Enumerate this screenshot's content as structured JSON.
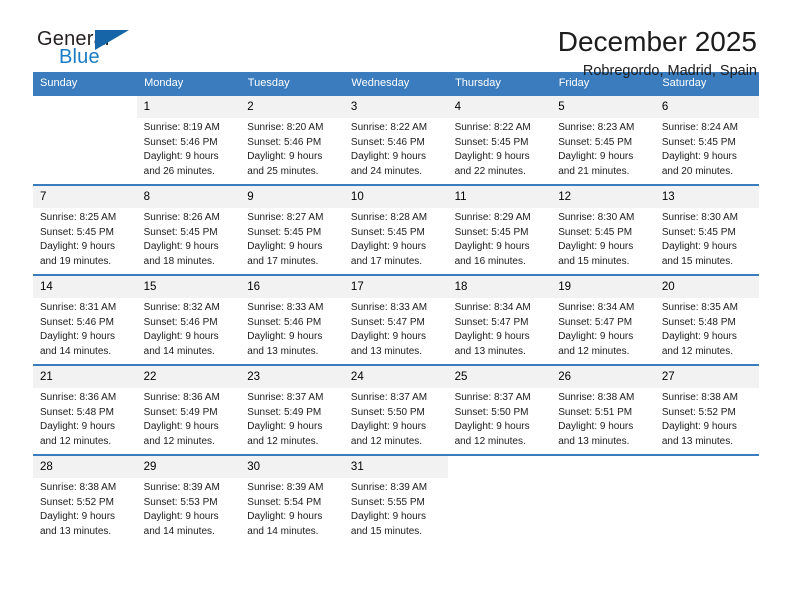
{
  "brand": {
    "name_part1": "General",
    "name_part2": "Blue",
    "triangle_color": "#1565a8",
    "blue_text_color": "#1a7cc4"
  },
  "header": {
    "title": "December 2025",
    "subtitle": "Robregordo, Madrid, Spain"
  },
  "theme": {
    "header_row_bg": "#3a7cbe",
    "daynum_bg": "#f2f2f2",
    "text_color": "#1c1c1c"
  },
  "calendar": {
    "weekday_headers": [
      "Sunday",
      "Monday",
      "Tuesday",
      "Wednesday",
      "Thursday",
      "Friday",
      "Saturday"
    ],
    "weeks": [
      [
        {
          "day": "",
          "lines": []
        },
        {
          "day": "1",
          "lines": [
            "Sunrise: 8:19 AM",
            "Sunset: 5:46 PM",
            "Daylight: 9 hours",
            "and 26 minutes."
          ]
        },
        {
          "day": "2",
          "lines": [
            "Sunrise: 8:20 AM",
            "Sunset: 5:46 PM",
            "Daylight: 9 hours",
            "and 25 minutes."
          ]
        },
        {
          "day": "3",
          "lines": [
            "Sunrise: 8:22 AM",
            "Sunset: 5:46 PM",
            "Daylight: 9 hours",
            "and 24 minutes."
          ]
        },
        {
          "day": "4",
          "lines": [
            "Sunrise: 8:22 AM",
            "Sunset: 5:45 PM",
            "Daylight: 9 hours",
            "and 22 minutes."
          ]
        },
        {
          "day": "5",
          "lines": [
            "Sunrise: 8:23 AM",
            "Sunset: 5:45 PM",
            "Daylight: 9 hours",
            "and 21 minutes."
          ]
        },
        {
          "day": "6",
          "lines": [
            "Sunrise: 8:24 AM",
            "Sunset: 5:45 PM",
            "Daylight: 9 hours",
            "and 20 minutes."
          ]
        }
      ],
      [
        {
          "day": "7",
          "lines": [
            "Sunrise: 8:25 AM",
            "Sunset: 5:45 PM",
            "Daylight: 9 hours",
            "and 19 minutes."
          ]
        },
        {
          "day": "8",
          "lines": [
            "Sunrise: 8:26 AM",
            "Sunset: 5:45 PM",
            "Daylight: 9 hours",
            "and 18 minutes."
          ]
        },
        {
          "day": "9",
          "lines": [
            "Sunrise: 8:27 AM",
            "Sunset: 5:45 PM",
            "Daylight: 9 hours",
            "and 17 minutes."
          ]
        },
        {
          "day": "10",
          "lines": [
            "Sunrise: 8:28 AM",
            "Sunset: 5:45 PM",
            "Daylight: 9 hours",
            "and 17 minutes."
          ]
        },
        {
          "day": "11",
          "lines": [
            "Sunrise: 8:29 AM",
            "Sunset: 5:45 PM",
            "Daylight: 9 hours",
            "and 16 minutes."
          ]
        },
        {
          "day": "12",
          "lines": [
            "Sunrise: 8:30 AM",
            "Sunset: 5:45 PM",
            "Daylight: 9 hours",
            "and 15 minutes."
          ]
        },
        {
          "day": "13",
          "lines": [
            "Sunrise: 8:30 AM",
            "Sunset: 5:45 PM",
            "Daylight: 9 hours",
            "and 15 minutes."
          ]
        }
      ],
      [
        {
          "day": "14",
          "lines": [
            "Sunrise: 8:31 AM",
            "Sunset: 5:46 PM",
            "Daylight: 9 hours",
            "and 14 minutes."
          ]
        },
        {
          "day": "15",
          "lines": [
            "Sunrise: 8:32 AM",
            "Sunset: 5:46 PM",
            "Daylight: 9 hours",
            "and 14 minutes."
          ]
        },
        {
          "day": "16",
          "lines": [
            "Sunrise: 8:33 AM",
            "Sunset: 5:46 PM",
            "Daylight: 9 hours",
            "and 13 minutes."
          ]
        },
        {
          "day": "17",
          "lines": [
            "Sunrise: 8:33 AM",
            "Sunset: 5:47 PM",
            "Daylight: 9 hours",
            "and 13 minutes."
          ]
        },
        {
          "day": "18",
          "lines": [
            "Sunrise: 8:34 AM",
            "Sunset: 5:47 PM",
            "Daylight: 9 hours",
            "and 13 minutes."
          ]
        },
        {
          "day": "19",
          "lines": [
            "Sunrise: 8:34 AM",
            "Sunset: 5:47 PM",
            "Daylight: 9 hours",
            "and 12 minutes."
          ]
        },
        {
          "day": "20",
          "lines": [
            "Sunrise: 8:35 AM",
            "Sunset: 5:48 PM",
            "Daylight: 9 hours",
            "and 12 minutes."
          ]
        }
      ],
      [
        {
          "day": "21",
          "lines": [
            "Sunrise: 8:36 AM",
            "Sunset: 5:48 PM",
            "Daylight: 9 hours",
            "and 12 minutes."
          ]
        },
        {
          "day": "22",
          "lines": [
            "Sunrise: 8:36 AM",
            "Sunset: 5:49 PM",
            "Daylight: 9 hours",
            "and 12 minutes."
          ]
        },
        {
          "day": "23",
          "lines": [
            "Sunrise: 8:37 AM",
            "Sunset: 5:49 PM",
            "Daylight: 9 hours",
            "and 12 minutes."
          ]
        },
        {
          "day": "24",
          "lines": [
            "Sunrise: 8:37 AM",
            "Sunset: 5:50 PM",
            "Daylight: 9 hours",
            "and 12 minutes."
          ]
        },
        {
          "day": "25",
          "lines": [
            "Sunrise: 8:37 AM",
            "Sunset: 5:50 PM",
            "Daylight: 9 hours",
            "and 12 minutes."
          ]
        },
        {
          "day": "26",
          "lines": [
            "Sunrise: 8:38 AM",
            "Sunset: 5:51 PM",
            "Daylight: 9 hours",
            "and 13 minutes."
          ]
        },
        {
          "day": "27",
          "lines": [
            "Sunrise: 8:38 AM",
            "Sunset: 5:52 PM",
            "Daylight: 9 hours",
            "and 13 minutes."
          ]
        }
      ],
      [
        {
          "day": "28",
          "lines": [
            "Sunrise: 8:38 AM",
            "Sunset: 5:52 PM",
            "Daylight: 9 hours",
            "and 13 minutes."
          ]
        },
        {
          "day": "29",
          "lines": [
            "Sunrise: 8:39 AM",
            "Sunset: 5:53 PM",
            "Daylight: 9 hours",
            "and 14 minutes."
          ]
        },
        {
          "day": "30",
          "lines": [
            "Sunrise: 8:39 AM",
            "Sunset: 5:54 PM",
            "Daylight: 9 hours",
            "and 14 minutes."
          ]
        },
        {
          "day": "31",
          "lines": [
            "Sunrise: 8:39 AM",
            "Sunset: 5:55 PM",
            "Daylight: 9 hours",
            "and 15 minutes."
          ]
        },
        {
          "day": "",
          "lines": []
        },
        {
          "day": "",
          "lines": []
        },
        {
          "day": "",
          "lines": []
        }
      ]
    ]
  }
}
